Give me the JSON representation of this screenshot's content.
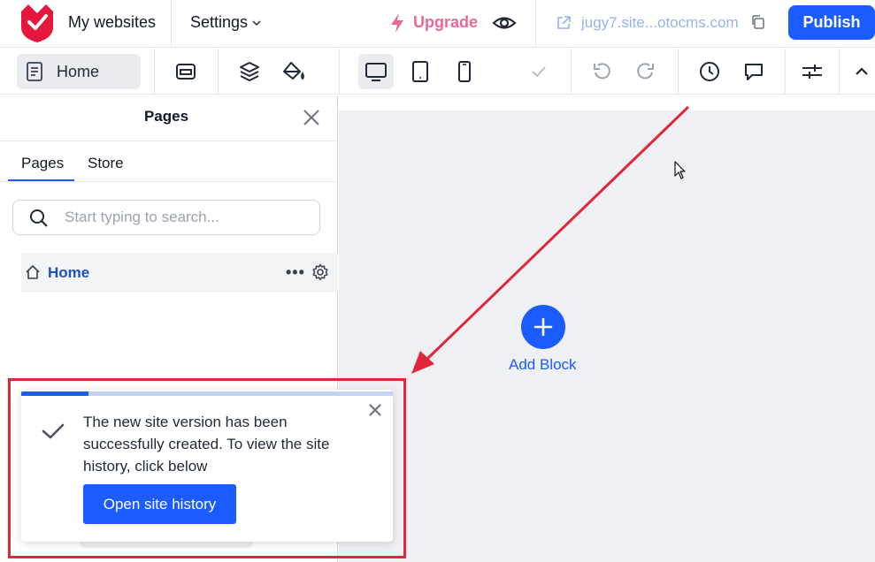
{
  "header": {
    "my_websites": "My websites",
    "settings": "Settings",
    "upgrade": "Upgrade",
    "site_url": "jugy7.site...otocms.com",
    "publish": "Publish"
  },
  "toolbar": {
    "current_page": "Home"
  },
  "canvas": {
    "add_block": "Add Block"
  },
  "panel": {
    "title": "Pages",
    "tabs": [
      "Pages",
      "Store"
    ],
    "search_placeholder": "Start typing to search...",
    "pages": [
      {
        "name": "Home",
        "more": "•••"
      }
    ]
  },
  "toast": {
    "message": "The new site version has been successfully created. To view the site history, click below",
    "button": "Open site history",
    "progress": 0.18
  },
  "colors": {
    "accent": "#1a5cff",
    "upgrade": "#e9689a",
    "annotation": "#e0263a"
  }
}
